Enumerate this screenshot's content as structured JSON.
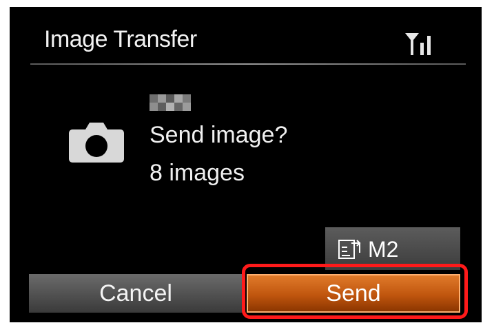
{
  "header": {
    "title": "Image Transfer",
    "signal_icon": "wifi-signal-icon"
  },
  "message": {
    "icon": "camera-icon",
    "device_name": "",
    "question": "Send image?",
    "count": "8 images"
  },
  "resize_badge": {
    "icon": "resize-icon",
    "label": "M2"
  },
  "buttons": {
    "cancel_label": "Cancel",
    "send_label": "Send"
  },
  "colors": {
    "background": "#000000",
    "send_accent": "#d06818",
    "highlight": "#ff1a1a"
  }
}
